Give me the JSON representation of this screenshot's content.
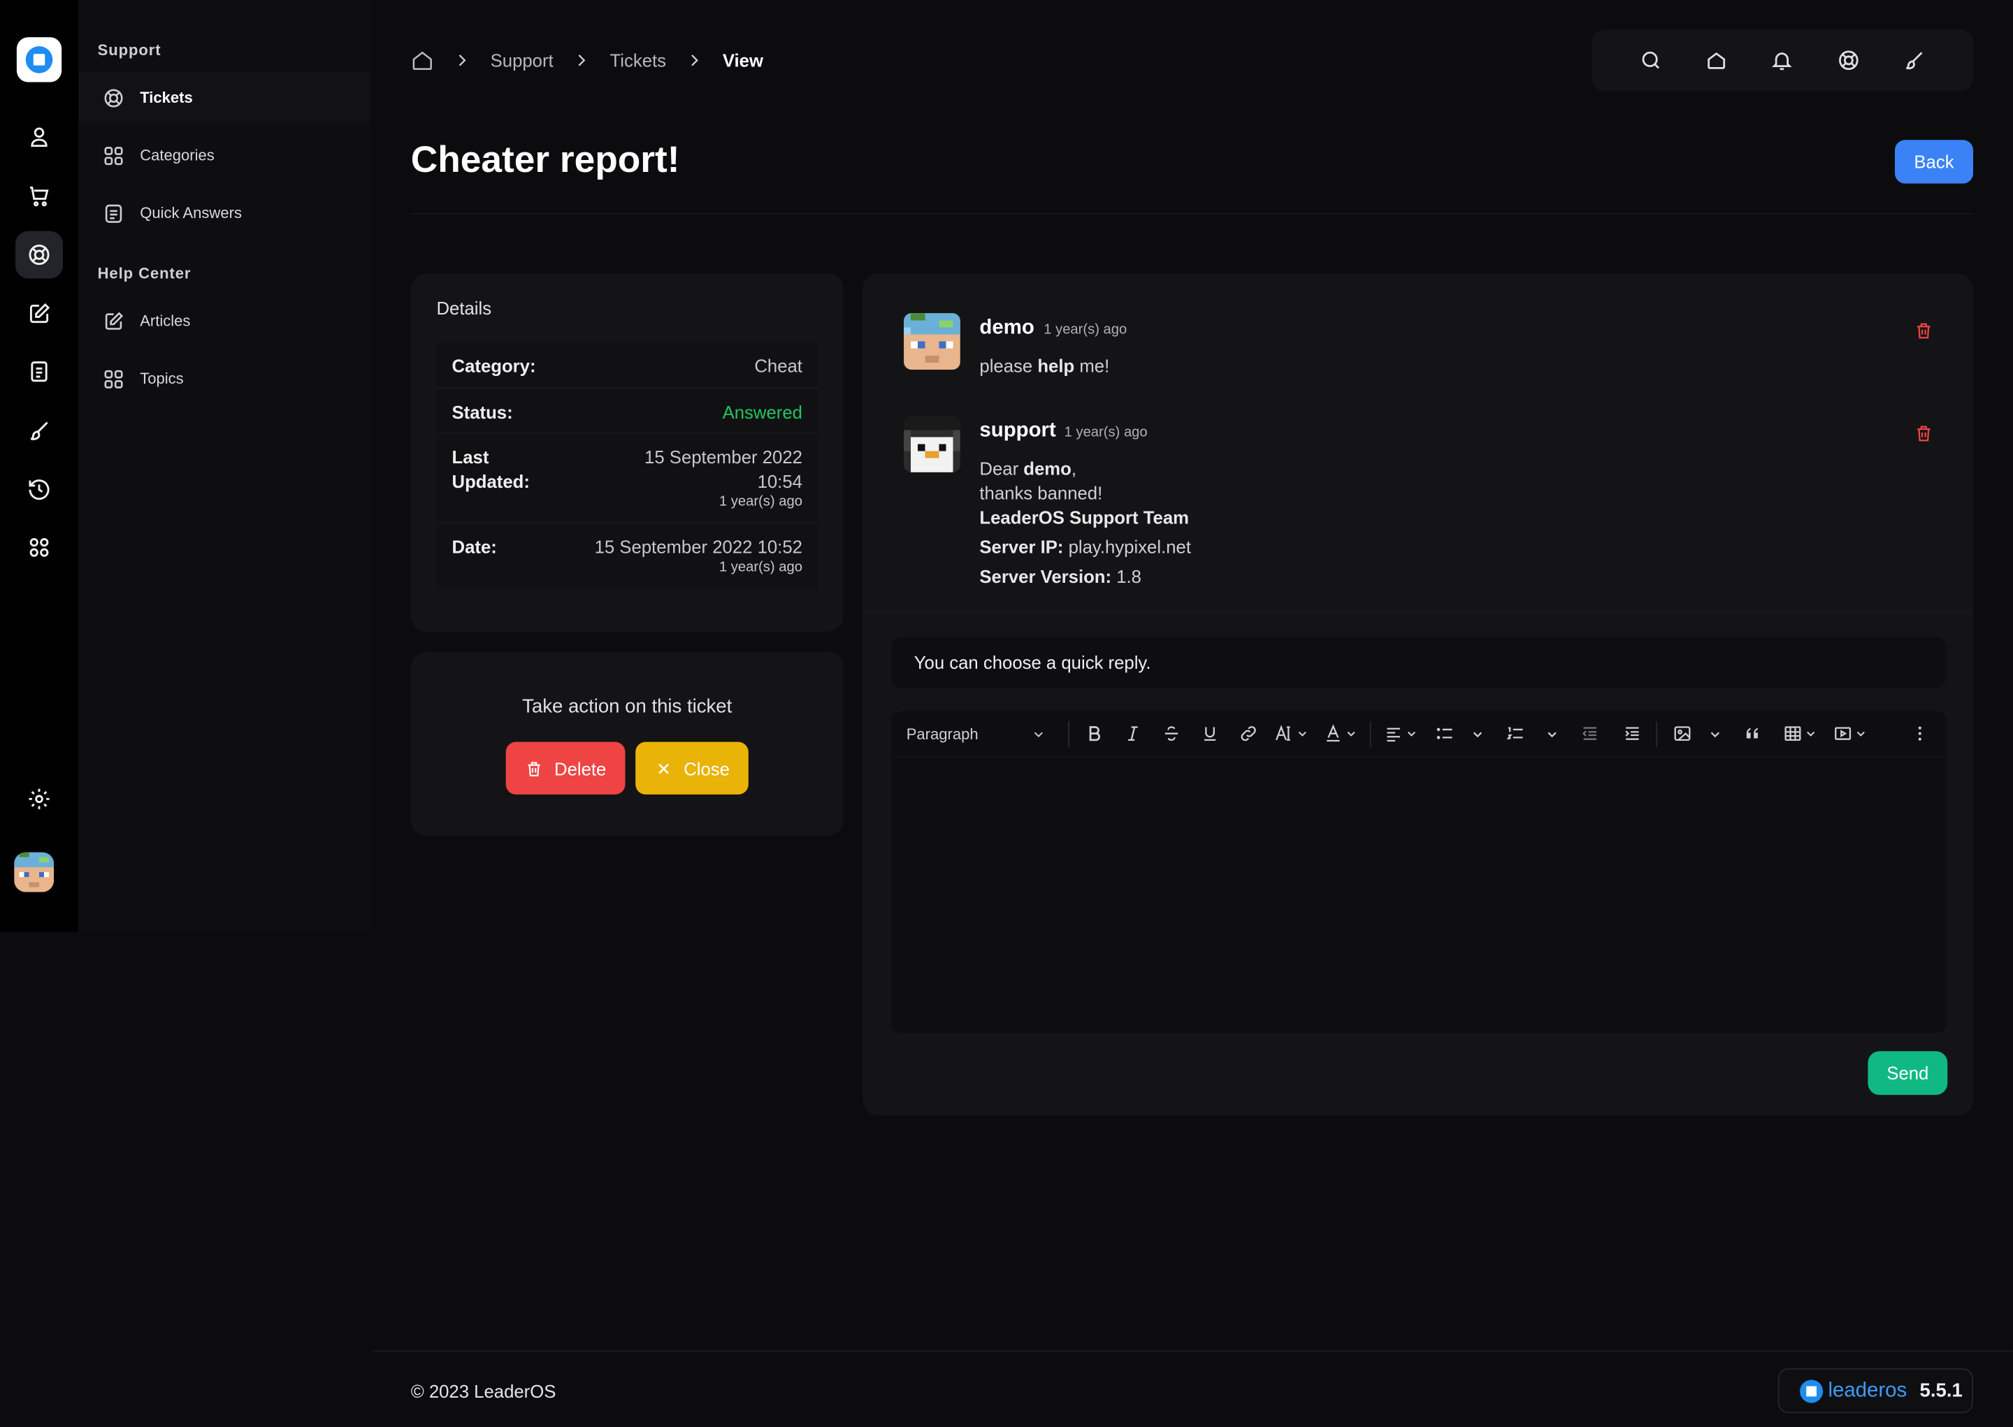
{
  "sidebar": {
    "section_support": "Support",
    "section_help": "Help Center",
    "items": [
      {
        "label": "Tickets"
      },
      {
        "label": "Categories"
      },
      {
        "label": "Quick Answers"
      },
      {
        "label": "Articles"
      },
      {
        "label": "Topics"
      }
    ]
  },
  "breadcrumb": [
    "Support",
    "Tickets",
    "View"
  ],
  "page": {
    "title": "Cheater report!",
    "back_label": "Back"
  },
  "details": {
    "title": "Details",
    "category_label": "Category:",
    "category_value": "Cheat",
    "status_label": "Status:",
    "status_value": "Answered",
    "updated_label_1": "Last",
    "updated_label_2": "Updated:",
    "updated_value_1": "15 September 2022",
    "updated_value_2": "10:54",
    "updated_ago": "1 year(s) ago",
    "date_label": "Date:",
    "date_value": "15 September 2022 10:52",
    "date_ago": "1 year(s) ago"
  },
  "action": {
    "title": "Take action on this ticket",
    "delete_label": "Delete",
    "close_label": "Close"
  },
  "messages": [
    {
      "user": "demo",
      "ago": "1 year(s) ago",
      "text_pre": "please ",
      "text_bold": "help",
      "text_post": " me!"
    },
    {
      "user": "support",
      "ago": "1 year(s) ago",
      "greeting_pre": "Dear ",
      "greeting_bold": "demo",
      "greeting_post": ",",
      "line2": "thanks banned!",
      "line3": "LeaderOS Support Team",
      "ip_label": "Server IP:",
      "ip_value": " play.hypixel.net",
      "ver_label": "Server Version:",
      "ver_value": " 1.8"
    }
  ],
  "quick_reply": {
    "placeholder": "You can choose a quick reply."
  },
  "editor": {
    "paragraph": "Paragraph"
  },
  "send_label": "Send",
  "footer": {
    "copyright": "© 2023 LeaderOS",
    "brand": "leaderos",
    "version": "5.5.1"
  },
  "colors": {
    "accent": "#3b82f6",
    "danger": "#ef4444",
    "warning": "#eab308",
    "success": "#10b981",
    "status_answered": "#22c55e"
  }
}
